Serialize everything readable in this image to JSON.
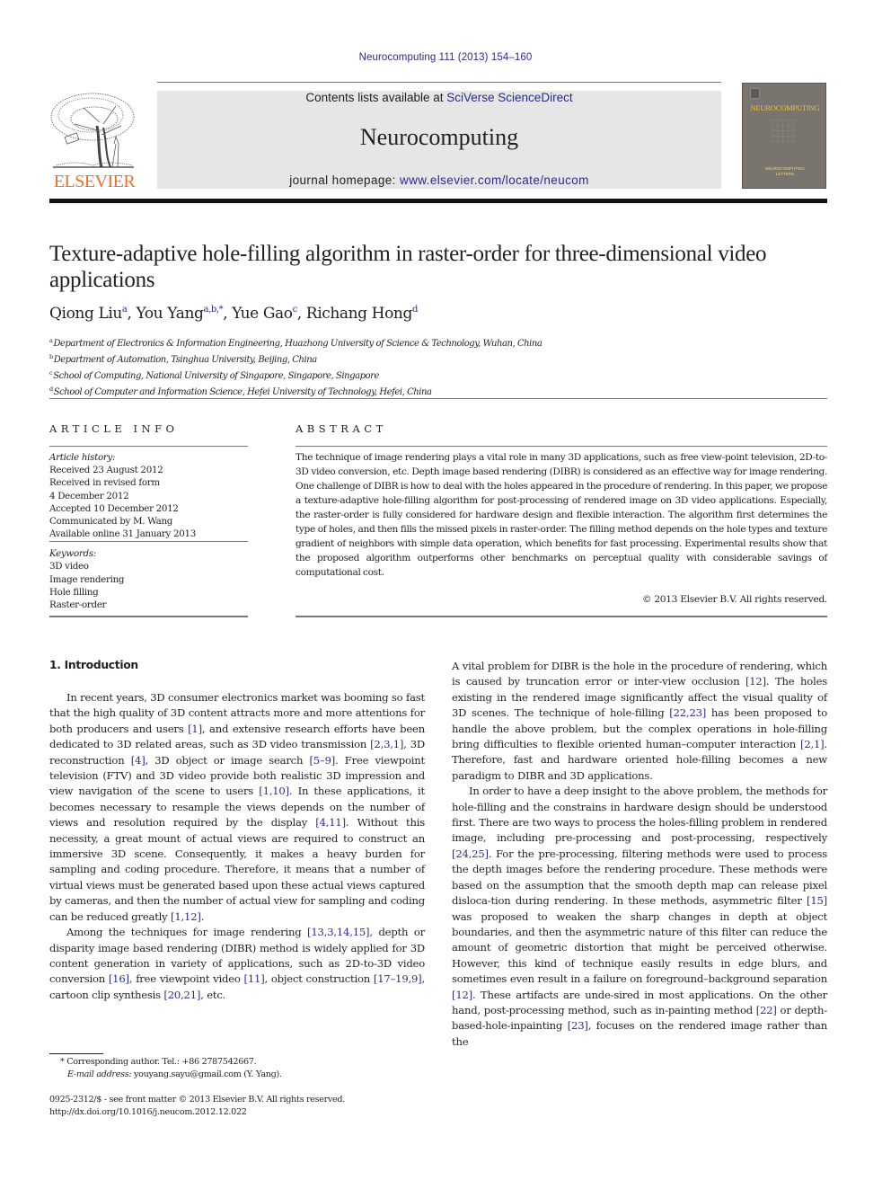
{
  "header": {
    "journal_ref": "Neurocomputing 111 (2013) 154–160",
    "contents_prefix": "Contents lists available at ",
    "contents_link": "SciVerse ScienceDirect",
    "journal_title": "Neurocomputing",
    "homepage_prefix": "journal homepage: ",
    "homepage_link": "www.elsevier.com/locate/neucom",
    "publisher_logo_text": "ELSEVIER",
    "cover_title": "NEUROCOMPUTING",
    "cover_subtitle_1": "NEUROCOMPUTING",
    "cover_subtitle_2": "LETTERS",
    "link_color": "#2b2b8c",
    "publisher_color": "#e8722a"
  },
  "article": {
    "title": "Texture-adaptive hole-filling algorithm in raster-order for three-dimensional video applications",
    "authors": [
      {
        "name": "Qiong Liu",
        "sup": "a",
        "sep": ", "
      },
      {
        "name": "You Yang",
        "sup": "a,b,*",
        "sep": ", "
      },
      {
        "name": "Yue Gao",
        "sup": "c",
        "sep": ", "
      },
      {
        "name": "Richang Hong",
        "sup": "d",
        "sep": ""
      }
    ],
    "affiliations": [
      {
        "mark": "a",
        "text": "Department of Electronics & Information Engineering, Huazhong University of Science & Technology, Wuhan, China"
      },
      {
        "mark": "b",
        "text": "Department of Automation, Tsinghua University, Beijing, China"
      },
      {
        "mark": "c",
        "text": "School of Computing, National University of Singapore, Singapore, Singapore"
      },
      {
        "mark": "d",
        "text": "School of Computer and Information Science, Hefei University of Technology, Hefei, China"
      }
    ]
  },
  "article_info": {
    "heading": "ARTICLE INFO",
    "history_label": "Article history:",
    "history": [
      "Received 23 August 2012",
      "Received in revised form",
      "4 December 2012",
      "Accepted 10 December 2012",
      "Communicated by M. Wang",
      "Available online 31 January 2013"
    ],
    "keywords_label": "Keywords:",
    "keywords": [
      "3D video",
      "Image rendering",
      "Hole filling",
      "Raster-order"
    ]
  },
  "abstract": {
    "heading": "ABSTRACT",
    "text": "The technique of image rendering plays a vital role in many 3D applications, such as free view-point television, 2D-to-3D video conversion, etc. Depth image based rendering (DIBR) is considered as an effective way for image rendering. One challenge of DIBR is how to deal with the holes appeared in the procedure of rendering. In this paper, we propose a texture-adaptive hole-filling algorithm for post-processing of rendered image on 3D video applications. Especially, the raster-order is fully considered for hardware design and flexible interaction. The algorithm first determines the type of holes, and then fills the missed pixels in raster-order. The filling method depends on the hole types and texture gradient of neighbors with simple data operation, which benefits for fast processing. Experimental results show that the proposed algorithm outperforms other benchmarks on perceptual quality with considerable savings of computational cost.",
    "copyright": "© 2013 Elsevier B.V. All rights reserved."
  },
  "introduction": {
    "heading": "1.  Introduction",
    "left_paragraphs": [
      [
        {
          "t": "In recent years, 3D consumer electronics market was booming so fast that the high quality of 3D content attracts more and more attentions for both producers and users "
        },
        {
          "c": "[1]"
        },
        {
          "t": ", and extensive research efforts have been dedicated to 3D related areas, such as 3D video transmission "
        },
        {
          "c": "[2,3,1]"
        },
        {
          "t": ", 3D reconstruction "
        },
        {
          "c": "[4]"
        },
        {
          "t": ", 3D object or image search "
        },
        {
          "c": "[5–9]"
        },
        {
          "t": ". Free viewpoint television (FTV) and 3D video provide both realistic 3D impression and view navigation of the scene to users "
        },
        {
          "c": "[1,10]"
        },
        {
          "t": ". In these applications, it becomes necessary to resample the views depends on the number of views and resolution required by the display "
        },
        {
          "c": "[4,11]"
        },
        {
          "t": ". Without this necessity, a great mount of actual views are required to construct an immersive 3D scene. Consequently, it makes a heavy burden for sampling and coding procedure. Therefore, it means that a number of virtual views must be generated based upon these actual views captured by cameras, and then the number of actual view for sampling and coding can be reduced greatly "
        },
        {
          "c": "[1,12]"
        },
        {
          "t": "."
        }
      ],
      [
        {
          "t": "Among the techniques for image rendering "
        },
        {
          "c": "[13,3,14,15]"
        },
        {
          "t": ", depth or disparity image based rendering (DIBR) method is widely applied for 3D content generation in variety of applications, such as 2D-to-3D video conversion "
        },
        {
          "c": "[16]"
        },
        {
          "t": ", free viewpoint video "
        },
        {
          "c": "[11]"
        },
        {
          "t": ", object construction "
        },
        {
          "c": "[17–19,9]"
        },
        {
          "t": ", cartoon clip synthesis "
        },
        {
          "c": "[20,21]"
        },
        {
          "t": ", etc."
        }
      ]
    ],
    "right_paragraphs": [
      [
        {
          "t": "A vital problem for DIBR is the hole in the procedure of rendering, which is caused by truncation error or inter-view occlusion "
        },
        {
          "c": "[12]"
        },
        {
          "t": ". The holes existing in the rendered image significantly affect the visual quality of 3D scenes. The technique of hole-filling "
        },
        {
          "c": "[22,23]"
        },
        {
          "t": " has been proposed to handle the above problem, but the complex operations in hole-filling bring difficulties to flexible oriented human–computer interaction "
        },
        {
          "c": "[2,1]"
        },
        {
          "t": ". Therefore, fast and hardware oriented hole-filling becomes a new paradigm to DIBR and 3D applications."
        }
      ],
      [
        {
          "t": "In order to have a deep insight to the above problem, the methods for hole-filling and the constrains in hardware design should be understood first. There are two ways to process the holes-filling problem in rendered image, including pre-processing and post-processing, respectively "
        },
        {
          "c": "[24,25]"
        },
        {
          "t": ". For the pre-processing, filtering methods were used to process the depth images before the rendering procedure. These methods were based on the assumption that the smooth depth map can release pixel disloca-tion during rendering. In these methods, asymmetric filter "
        },
        {
          "c": "[15]"
        },
        {
          "t": " was proposed to weaken the sharp changes in depth at object boundaries, and then the asymmetric nature of this filter can reduce the amount of geometric distortion that might be perceived otherwise. However, this kind of technique easily results in edge blurs, and sometimes even result in a failure on foreground–background separation "
        },
        {
          "c": "[12]"
        },
        {
          "t": ". These artifacts are unde-sired in most applications. On the other hand, post-processing method, such as in-painting method "
        },
        {
          "c": "[22]"
        },
        {
          "t": " or depth-based-hole-inpainting "
        },
        {
          "c": "[23]"
        },
        {
          "t": ", focuses on the rendered image rather than the"
        }
      ]
    ]
  },
  "footnotes": {
    "corresponding": "* Corresponding author. Tel.: +86 2787542667.",
    "email_label": "E-mail address:",
    "email_value": " youyang.sayu@gmail.com (Y. Yang).",
    "front_matter": "0925-2312/$ - see front matter © 2013 Elsevier B.V. All rights reserved.",
    "doi": "http://dx.doi.org/10.1016/j.neucom.2012.12.022"
  }
}
